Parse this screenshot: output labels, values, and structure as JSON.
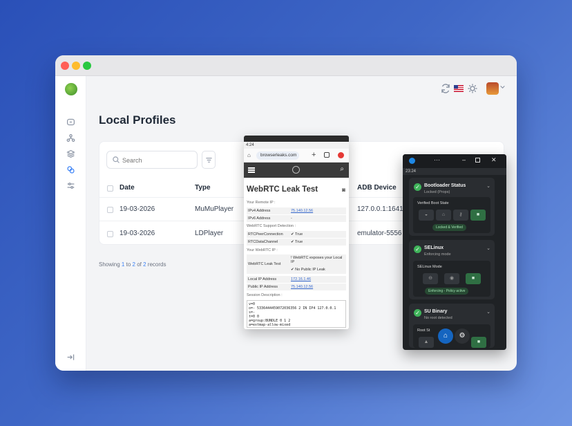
{
  "page": {
    "title": "Local Profiles",
    "search_placeholder": "Search",
    "footer": {
      "prefix": "Showing",
      "from": "1",
      "to_word": "to",
      "to": "2",
      "of_word": "of",
      "total": "2",
      "suffix": "records"
    }
  },
  "table": {
    "columns": [
      "Date",
      "Type",
      "ADB Device"
    ],
    "rows": [
      {
        "date": "19-03-2026",
        "type": "MuMuPlayer",
        "adb": "127.0.0.1:16416"
      },
      {
        "date": "19-03-2026",
        "type": "LDPlayer",
        "adb": "emulator-5556"
      }
    ]
  },
  "phone": {
    "time": "4:24",
    "url": "browserleaks.com",
    "title": "WebRTC Leak Test",
    "remote_ip_heading": "Your Remote IP :",
    "ipv4_label": "IPv4 Address",
    "ipv4_value": "75.140.12.56",
    "ipv6_label": "IPv6 Address",
    "ipv6_value": "-",
    "support_heading": "WebRTC Support Detection :",
    "rtcpc_label": "RTCPeerConnection",
    "rtcpc_value": "✔ True",
    "rtcdc_label": "RTCDataChannel",
    "rtcdc_value": "✔ True",
    "webrtc_ip_heading": "Your WebRTC IP :",
    "leak_label": "WebRTC Leak Test",
    "leak_value_1": "! WebRTC exposes your Local IP",
    "leak_value_2": "✔ No Public IP Leak",
    "local_ip_label": "Local IP Address",
    "local_ip_value": "172.16.1.46",
    "public_ip_label": "Public IP Address",
    "public_ip_value": "75.140.12.56",
    "session_heading": "Session Description :",
    "sdp": "v=0\no=- 5336444459072036356 2 IN IP4 127.0.0.1\ns=-\nt=0 0\na=group:BUNDLE 0 1 2\na=extmap-allow-mixed"
  },
  "root_panel": {
    "time": "23:24",
    "bootloader": {
      "title": "Bootloader Status",
      "subtitle": "Locked (Props)",
      "inner_label": "Verified Boot State",
      "badge": "Locked & Verified"
    },
    "selinux": {
      "title": "SELinux",
      "subtitle": "Enforcing mode",
      "inner_label": "SELinux Mode",
      "badge": "Enforcing - Policy active"
    },
    "su": {
      "title": "SU Binary",
      "subtitle": "No root detected",
      "inner_label": "Root St"
    }
  },
  "colors": {
    "accent": "#3b82f6",
    "ok_green": "#3fb35a",
    "background_start": "#2a50b8",
    "background_end": "#6f95e2"
  },
  "icons": [
    "refresh-icon",
    "us-flag-icon",
    "sun-icon",
    "avatar",
    "chevron-down-icon",
    "home-icon",
    "network-icon",
    "layers-icon",
    "link-icon",
    "sliders-icon",
    "collapse-icon",
    "search-icon",
    "filter-icon"
  ]
}
